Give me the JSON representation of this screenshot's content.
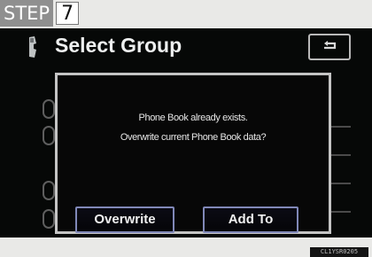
{
  "step": {
    "label": "STEP",
    "number": "7"
  },
  "screen": {
    "title": "Select Group",
    "back_button_icon": "return-arrow-icon",
    "phone_icon": "phone-handset-icon"
  },
  "dialog": {
    "line1": "Phone Book already exists.",
    "line2": "Overwrite current Phone Book data?",
    "overwrite_label": "Overwrite",
    "add_to_label": "Add To"
  },
  "photo_code": "CL1YSR0205"
}
